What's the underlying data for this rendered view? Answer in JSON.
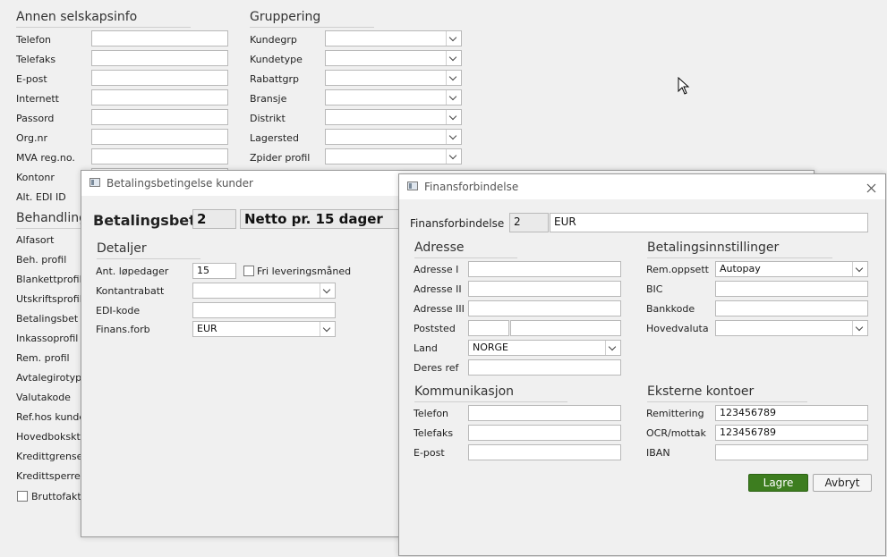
{
  "background": {
    "annen": {
      "title": "Annen selskapsinfo",
      "fields": [
        "Telefon",
        "Telefaks",
        "E-post",
        "Internett",
        "Passord",
        "Org.nr",
        "MVA reg.no.",
        "Kontonr",
        "Alt. EDI ID"
      ]
    },
    "gruppering": {
      "title": "Gruppering",
      "fields": [
        "Kundegrp",
        "Kundetype",
        "Rabattgrp",
        "Bransje",
        "Distrikt",
        "Lagersted",
        "Zpider profil"
      ]
    },
    "behandling": {
      "title": "Behandling",
      "fields": [
        "Alfasort",
        "Beh. profil",
        "Blankettprofil",
        "Utskriftsprofil",
        "Betalingsbet",
        "Inkassoprofil",
        "Rem. profil",
        "Avtalegirotype",
        "Valutakode",
        "Ref.hos kunde",
        "Hovedbokskto",
        "Kredittgrense",
        "Kredittsperre"
      ],
      "checkbox_label": "Bruttofaktu"
    }
  },
  "betaling_window": {
    "title": "Betalingsbetingelse kunder",
    "header_label": "Betalingsbet",
    "header_code": "2",
    "header_desc": "Netto pr. 15 dager",
    "section_title": "Detaljer",
    "days_label": "Ant. løpedager",
    "days_value": "15",
    "free_month_label": "Fri leveringsmåned",
    "cash_discount_label": "Kontantrabatt",
    "cash_discount_value": "",
    "edi_label": "EDI-kode",
    "edi_value": "",
    "finans_label": "Finans.forb",
    "finans_value": "EUR"
  },
  "finans_window": {
    "title": "Finansforbindelse",
    "header_label": "Finansforbindelse",
    "header_code": "2",
    "header_value": "EUR",
    "adresse": {
      "title": "Adresse",
      "adr1_label": "Adresse I",
      "adr2_label": "Adresse II",
      "adr3_label": "Adresse III",
      "poststed_label": "Poststed",
      "land_label": "Land",
      "land_value": "NORGE",
      "deres_ref_label": "Deres ref"
    },
    "betaling": {
      "title": "Betalingsinnstillinger",
      "rem_label": "Rem.oppsett",
      "rem_value": "Autopay",
      "bic_label": "BIC",
      "bank_label": "Bankkode",
      "valuta_label": "Hovedvaluta"
    },
    "kommunikasjon": {
      "title": "Kommunikasjon",
      "tlf_label": "Telefon",
      "fax_label": "Telefaks",
      "epost_label": "E-post"
    },
    "eksterne": {
      "title": "Eksterne kontoer",
      "rem_label": "Remittering",
      "rem_value": "123456789",
      "ocr_label": "OCR/mottak",
      "ocr_value": "123456789",
      "iban_label": "IBAN"
    },
    "save_label": "Lagre",
    "cancel_label": "Avbryt"
  }
}
